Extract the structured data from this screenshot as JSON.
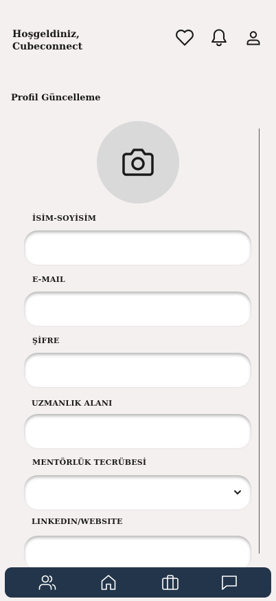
{
  "header": {
    "greeting_line1": "Hoşgeldiniz,",
    "greeting_line2": "Cubeconnect"
  },
  "page": {
    "title": "Profil Güncelleme"
  },
  "form": {
    "name_label": "İSİM-SOYİSİM",
    "email_label": "E-MAIL",
    "password_label": "ŞİFRE",
    "expertise_label": "UZMANLIK ALANI",
    "mentoring_label": "MENTÖRLÜK TECRÜBESİ",
    "linkedin_label": "LINKEDIN/WEBSITE",
    "name_value": "",
    "email_value": "",
    "password_value": "",
    "expertise_value": "",
    "mentoring_value": "",
    "linkedin_value": ""
  },
  "icons": {
    "favorites": "heart-icon",
    "notifications": "bell-icon",
    "profile": "user-icon",
    "photo": "camera-icon",
    "dropdown": "chevron-down-icon",
    "nav_people": "people-icon",
    "nav_home": "home-icon",
    "nav_work": "briefcase-icon",
    "nav_chat": "chat-icon"
  },
  "colors": {
    "background": "#f5f0f0",
    "nav_bar": "#23354a",
    "photo_circle": "#d9d9d9",
    "field": "#ffffff"
  }
}
